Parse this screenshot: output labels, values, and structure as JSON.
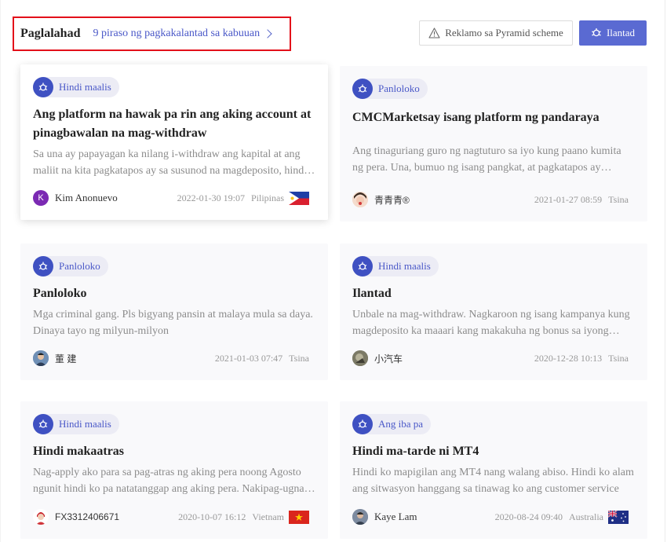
{
  "header": {
    "title": "Paglalahad",
    "link": "9 piraso ng pagkakalantad sa kabuuan"
  },
  "actions": {
    "report_label": "Reklamo sa Pyramid scheme",
    "expose_label": "Ilantad"
  },
  "colors": {
    "accent": "#5a6ad2",
    "tag_icon": "#3f51c2",
    "highlight_border": "#e3101a"
  },
  "cards": [
    {
      "tag": "Hindi maalis",
      "title": "Ang platform na hawak pa rin ang aking account at pinagbawalan na mag-withdraw",
      "desc": "Sa una ay papayagan ka nilang i-withdraw ang kapital at ang maliit na kita pagkatapos ay sa susunod na magdeposito, hindi ka na makakapag-withdraw",
      "avatar_letter": "K",
      "user": "Kim Anonuevo",
      "date": "2022-01-30 19:07",
      "location": "Pilipinas",
      "flag": "ph-flag-icon"
    },
    {
      "tag": "Panloloko",
      "title": "CMCMarketsay isang platform ng pandaraya",
      "desc": "Ang tinaguriang guro ng nagtuturo sa iyo kung paano kumita ng pera. Una, bumuo ng isang pangkat, at pagkatapos ay hinihikayat kang mamuhunan",
      "user": "青青青®",
      "date": "2021-01-27 08:59",
      "location": "Tsina"
    },
    {
      "tag": "Panloloko",
      "title": "Panloloko",
      "desc": "Mga criminal gang. Pls bigyang pansin at malaya mula sa daya. Dinaya tayo ng milyun-milyon",
      "user": "董 建",
      "date": "2021-01-03 07:47",
      "location": "Tsina"
    },
    {
      "tag": "Hindi maalis",
      "title": "Ilantad",
      "desc": "Unbale na mag-withdraw. Nagkaroon ng isang kampanya kung magdeposito ka maaari kang makakuha ng bonus sa iyong account",
      "user": "小汽车",
      "date": "2020-12-28 10:13",
      "location": "Tsina"
    },
    {
      "tag": "Hindi maalis",
      "title": "Hindi makaatras",
      "desc": "Nag-apply ako para sa pag-atras ng aking pera noong Agosto ngunit hindi ko pa natatanggap ang aking pera. Nakipag-ugnay ako sa kanila ngunit walang sagot",
      "user": "FX3312406671",
      "date": "2020-10-07 16:12",
      "location": "Vietnam",
      "flag": "vn-flag-icon"
    },
    {
      "tag": "Ang iba pa",
      "title": "Hindi ma-tarde ni MT4",
      "desc": "Hindi ko mapigilan ang MT4 nang walang abiso. Hindi ko alam ang sitwasyon hanggang sa tinawag ko ang customer service",
      "user": "Kaye Lam",
      "date": "2020-08-24 09:40",
      "location": "Australia",
      "flag": "au-flag-icon"
    }
  ]
}
